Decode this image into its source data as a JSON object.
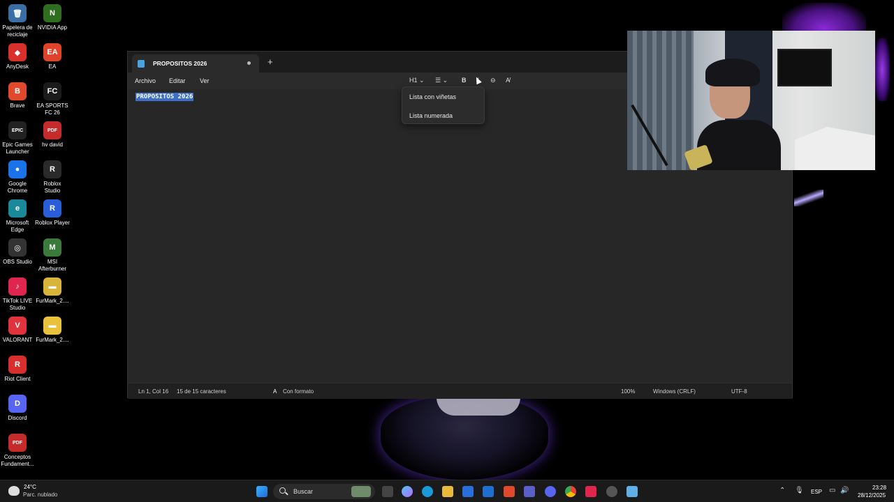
{
  "desktop": {
    "icons": [
      {
        "label": "Papelera de\nreciclaje",
        "glyph": "🗑",
        "color": "#3a6ea5"
      },
      {
        "label": "NVIDIA App",
        "glyph": "N",
        "color": "#2f6e1f"
      },
      {
        "label": "AnyDesk",
        "glyph": "◆",
        "color": "#d9302c"
      },
      {
        "label": "EA",
        "glyph": "EA",
        "color": "#e0432b"
      },
      {
        "label": "Brave",
        "glyph": "B",
        "color": "#e0492c"
      },
      {
        "label": "EA SPORTS\nFC 26",
        "glyph": "FC",
        "color": "#1b1b1b"
      },
      {
        "label": "Epic Games\nLauncher",
        "glyph": "EPIC",
        "color": "#222"
      },
      {
        "label": "hv david",
        "glyph": "PDF",
        "color": "#c62b2b"
      },
      {
        "label": "Google\nChrome",
        "glyph": "●",
        "color": "#1a73e8"
      },
      {
        "label": "Roblox\nStudio",
        "glyph": "R",
        "color": "#2a2a2a"
      },
      {
        "label": "Microsoft\nEdge",
        "glyph": "e",
        "color": "#1a8a9a"
      },
      {
        "label": "Roblox Player",
        "glyph": "R",
        "color": "#2a5ed8"
      },
      {
        "label": "OBS Studio",
        "glyph": "◎",
        "color": "#333"
      },
      {
        "label": "MSI\nAfterburner",
        "glyph": "M",
        "color": "#3a7a3a"
      },
      {
        "label": "TikTok LIVE\nStudio",
        "glyph": "♪",
        "color": "#e0264f"
      },
      {
        "label": "FurMark_2....",
        "glyph": "▬",
        "color": "#d9b43a"
      },
      {
        "label": "VALORANT",
        "glyph": "V",
        "color": "#e0333d"
      },
      {
        "label": "FurMark_2....",
        "glyph": "▬",
        "color": "#e8c23a"
      },
      {
        "label": "Riot Client",
        "glyph": "R",
        "color": "#d92e2e"
      },
      {
        "label": "Discord",
        "glyph": "D",
        "color": "#5865f2"
      },
      {
        "label": "Conceptos\nFundament...",
        "glyph": "PDF",
        "color": "#c62b2b"
      }
    ]
  },
  "notepad": {
    "tab_title": "PROPOSITOS 2026",
    "new_tab": "+",
    "menu": {
      "file": "Archivo",
      "edit": "Editar",
      "view": "Ver"
    },
    "toolbar": {
      "heading": "H1 ⌄",
      "list": "☰ ⌄",
      "bold": "B",
      "italic": "I",
      "link": "⊖",
      "clear": "A̸"
    },
    "content": "PROPOSITOS 2026",
    "dropdown": {
      "item1": "Lista con viñetas",
      "item2": "Lista numerada"
    },
    "status": {
      "position": "Ln 1, Col 16",
      "chars": "15 de 15 caracteres",
      "format": "Con formato",
      "zoom": "100%",
      "line_ending": "Windows (CRLF)",
      "encoding": "UTF-8"
    }
  },
  "taskbar": {
    "weather_temp": "24°C",
    "weather_desc": "Parc. nublado",
    "search_placeholder": "Buscar",
    "language": "ESP",
    "time": "23:28",
    "date": "28/12/2025"
  }
}
